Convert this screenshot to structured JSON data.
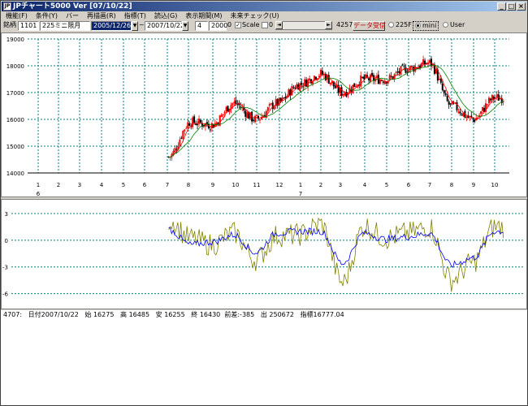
{
  "window": {
    "title": "JPチャート5000 Ver [07/10/22]",
    "icon_text": "JP",
    "controls": [
      "minimize-icon",
      "maximize-icon",
      "close-icon"
    ]
  },
  "menu": [
    "機能(F)",
    "条件(Y)",
    "バー",
    "再描画(R)",
    "指標(T)",
    "読込(G)",
    "表示期間(M)",
    "未来チェック(U)"
  ],
  "toolbar": {
    "label_code": "銘柄",
    "code": "1101",
    "name": "225ミニ限月",
    "date_from": "2005/12/26",
    "date_sep": "~",
    "date_to": "2007/10/22",
    "field_a": "4",
    "field_b": "2000",
    "field_c": "0",
    "scale_label": "Scale",
    "scale_value": "0",
    "count": "4257",
    "receive_button": "データ受信",
    "radio_options": [
      "225F",
      "mini",
      "User"
    ],
    "radio_selected": "mini"
  },
  "price_chart": {
    "y_ticks": [
      "19000",
      "18000",
      "17000",
      "16000",
      "15000",
      "14000"
    ],
    "x_month_ticks": [
      "1",
      "2",
      "3",
      "4",
      "5",
      "6",
      "7",
      "8",
      "9",
      "10",
      "11",
      "12",
      "1",
      "2",
      "3",
      "4",
      "5",
      "6",
      "7",
      "8",
      "9",
      "10"
    ],
    "x_year_labels": [
      "6",
      "7"
    ]
  },
  "osc_chart": {
    "y_ticks": [
      "3",
      "0",
      "-3",
      "-6"
    ]
  },
  "status": {
    "text": "4707:   日付2007/10/22   始 16275   高 16485   安 16255   終 16430  前差:-385   出 250672   指標16777.04"
  },
  "colors": {
    "candle_up": "#ff0000",
    "candle_down": "#000000",
    "ma_short": "#ff0000",
    "ma_long": "#008000",
    "osc_fast": "#808000",
    "osc_slow": "#0000ff",
    "grid": "#008080"
  },
  "chart_data": [
    {
      "type": "line",
      "title": "",
      "xlabel": "",
      "ylabel": "",
      "ylim": [
        14000,
        19000
      ],
      "grid": true,
      "x": [
        "2006-01",
        "2006-02",
        "2006-03",
        "2006-04",
        "2006-05",
        "2006-06",
        "2006-07",
        "2006-08",
        "2006-09",
        "2006-10",
        "2006-11",
        "2006-12",
        "2007-01",
        "2007-02",
        "2007-03",
        "2007-04",
        "2007-05",
        "2007-06",
        "2007-07",
        "2007-08",
        "2007-09",
        "2007-10"
      ],
      "series": [
        {
          "values": [
            null,
            null,
            null,
            null,
            null,
            null,
            14600,
            15900,
            15800,
            16600,
            16000,
            16600,
            17300,
            17700,
            17000,
            17500,
            17500,
            17900,
            18100,
            16500,
            16000,
            16800
          ]
        }
      ]
    },
    {
      "type": "line",
      "title": "",
      "ylim": [
        -7.5,
        4
      ],
      "grid": true,
      "x": [
        "2006-01",
        "2006-02",
        "2006-03",
        "2006-04",
        "2006-05",
        "2006-06",
        "2006-07",
        "2006-08",
        "2006-09",
        "2006-10",
        "2006-11",
        "2006-12",
        "2007-01",
        "2007-02",
        "2007-03",
        "2007-04",
        "2007-05",
        "2007-06",
        "2007-07",
        "2007-08",
        "2007-09",
        "2007-10"
      ],
      "series": [
        {
          "values": [
            null,
            null,
            null,
            null,
            null,
            null,
            2.3,
            0.2,
            -0.5,
            0.8,
            -2.2,
            0.5,
            0.6,
            1.8,
            -4.8,
            1.6,
            0.2,
            0.8,
            1.5,
            -4.5,
            -2.5,
            1.5
          ]
        },
        {
          "values": [
            null,
            null,
            null,
            null,
            null,
            null,
            1.2,
            -0.5,
            -0.2,
            0.6,
            -1.4,
            0.8,
            1.0,
            1.0,
            -2.6,
            0.8,
            0.1,
            0.4,
            0.8,
            -2.8,
            -2.0,
            1.0
          ]
        }
      ]
    }
  ]
}
